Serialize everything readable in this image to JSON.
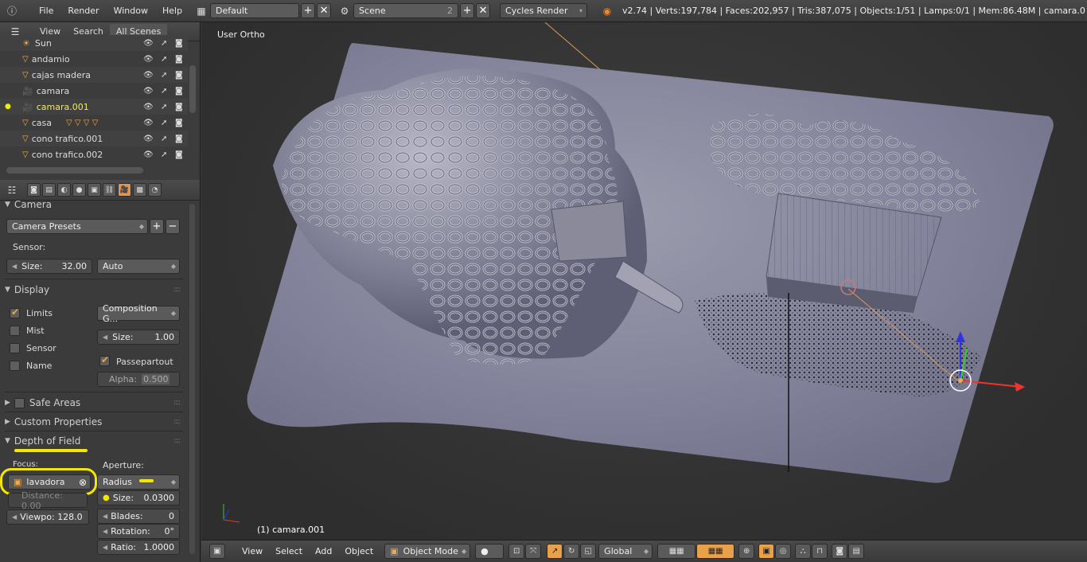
{
  "topbar": {
    "menus": [
      "File",
      "Render",
      "Window",
      "Help"
    ],
    "screen_layout": "Default",
    "scene": "Scene",
    "scene_users": "2",
    "render_engine": "Cycles Render",
    "stats": "v2.74 | Verts:197,784 | Faces:202,957 | Tris:387,075 | Objects:1/51 | Lamps:0/1 | Mem:86.48M | camara.0"
  },
  "outliner": {
    "tabs": [
      "View",
      "Search",
      "All Scenes"
    ],
    "items": [
      {
        "name": "Sun",
        "active": false
      },
      {
        "name": "andamio",
        "active": false
      },
      {
        "name": "cajas madera",
        "active": false
      },
      {
        "name": "camara",
        "active": false
      },
      {
        "name": "camara.001",
        "active": true
      },
      {
        "name": "casa",
        "active": false
      },
      {
        "name": "cono trafico.001",
        "active": false
      },
      {
        "name": "cono trafico.002",
        "active": false
      }
    ]
  },
  "properties": {
    "camera_panel": "Camera",
    "camera_presets": "Camera Presets",
    "sensor_label": "Sensor:",
    "size_label": "Size:",
    "size_value": "32.00",
    "sensor_fit": "Auto",
    "display_panel": "Display",
    "limits": "Limits",
    "mist": "Mist",
    "sensor": "Sensor",
    "name": "Name",
    "composition": "Composition G...",
    "display_size_label": "Size:",
    "display_size_value": "1.00",
    "passepartout": "Passepartout",
    "alpha_label": "Alpha:",
    "alpha_value": "0.500",
    "safe_areas": "Safe Areas",
    "custom_properties": "Custom Properties",
    "dof_panel": "Depth of Field",
    "focus_label": "Focus:",
    "aperture_label": "Aperture:",
    "focus_object": "lavadora",
    "aperture_type": "Radius",
    "distance": "Distance: 0.00",
    "ap_size_label": "Size:",
    "ap_size_value": "0.0300",
    "viewport": "Viewpo: 128.0",
    "blades_label": "Blades:",
    "blades_value": "0",
    "rotation_label": "Rotation:",
    "rotation_value": "0°",
    "ratio_label": "Ratio:",
    "ratio_value": "1.0000"
  },
  "viewport": {
    "view_name": "User Ortho",
    "active_object": "(1) camara.001"
  },
  "bottombar": {
    "menus": [
      "View",
      "Select",
      "Add",
      "Object"
    ],
    "mode": "Object Mode",
    "orientation": "Global"
  },
  "colors": {
    "accent": "#e8a04a",
    "highlight": "#f5e600",
    "active_text": "#f0e66a"
  }
}
